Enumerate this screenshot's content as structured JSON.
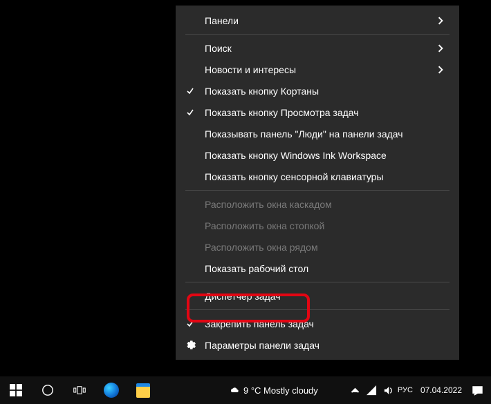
{
  "menu": {
    "panels": "Панели",
    "search": "Поиск",
    "news": "Новости и интересы",
    "cortana_btn": "Показать кнопку Кортаны",
    "taskview_btn": "Показать кнопку Просмотра задач",
    "people": "Показывать панель \"Люди\" на панели задач",
    "ink": "Показать кнопку Windows Ink Workspace",
    "keyboard": "Показать кнопку сенсорной клавиатуры",
    "cascade": "Расположить окна каскадом",
    "stack": "Расположить окна стопкой",
    "side": "Расположить окна рядом",
    "desktop": "Показать рабочий стол",
    "taskmgr": "Диспетчер задач",
    "lock": "Закрепить панель задач",
    "settings": "Параметры панели задач"
  },
  "taskbar": {
    "weather": "9 °C  Mostly cloudy",
    "date": "07.04.2022"
  }
}
